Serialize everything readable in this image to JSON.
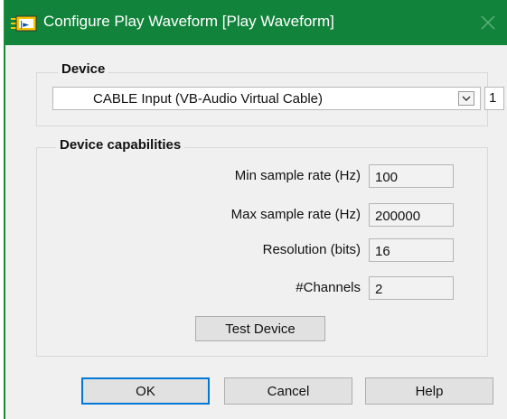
{
  "window": {
    "title": "Configure Play Waveform [Play Waveform]",
    "accent_color": "#12833b"
  },
  "device_group": {
    "label": "Device",
    "selected_device": "CABLE Input (VB-Audio Virtual Cable)",
    "index_value": "1"
  },
  "capabilities_group": {
    "label": "Device capabilities",
    "fields": [
      {
        "label": "Min sample rate (Hz)",
        "value": "100"
      },
      {
        "label": "Max sample rate (Hz)",
        "value": "200000"
      },
      {
        "label": "Resolution (bits)",
        "value": "16"
      },
      {
        "label": "#Channels",
        "value": "2"
      }
    ],
    "test_button_label": "Test Device"
  },
  "footer": {
    "ok_label": "OK",
    "cancel_label": "Cancel",
    "help_label": "Help"
  },
  "icons": {
    "app": "labview-vi-icon",
    "close": "close-icon",
    "dropdown": "chevron-down-icon"
  }
}
